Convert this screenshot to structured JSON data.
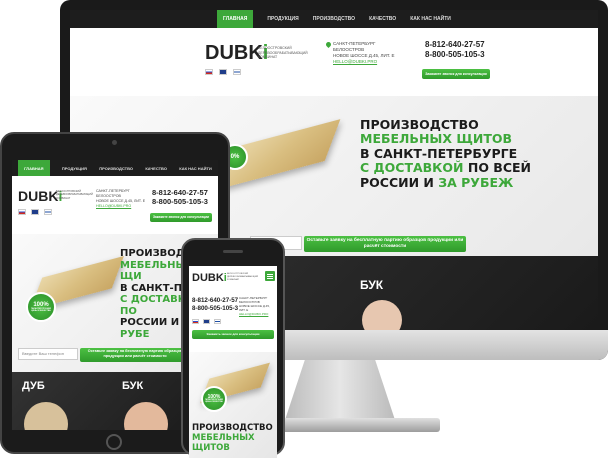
{
  "brand": {
    "logo_main": "DUBK",
    "logo_accent": "i",
    "tagline": "БЕЛООСТРОВСКИЙ ДЕРЕВООБРАБАТЫВАЮЩИЙ КОМБИНАТ"
  },
  "nav": [
    "ГЛАВНАЯ",
    "ПРОДУКЦИЯ",
    "ПРОИЗВОДСТВО",
    "КАЧЕСТВО",
    "КАК НАС НАЙТИ"
  ],
  "address": {
    "line1": "САНКТ-ПЕТЕРБУРГ",
    "line2": "БЕЛООСТРОВ",
    "line3": "НОВОЕ ШОССЕ Д.45, ЛИТ. Е",
    "email": "HELLO@DUBKI.PRO"
  },
  "phones": {
    "phone1": "8-812-640-27-57",
    "phone2": "8-800-505-105-3",
    "callback": "Закажите звонок для консультации",
    "callback_short": "Закажить звонок для консультации"
  },
  "hero": {
    "line1": "ПРОИЗВОДСТВО",
    "line2": "МЕБЕЛЬНЫХ ЩИТОВ",
    "line3": "В САНКТ-ПЕТЕРБУРГЕ",
    "line4a": "С ДОСТАВКОЙ",
    "line4b": " ПО ВСЕЙ",
    "line5a": "РОССИИ И ",
    "line5b": "ЗА РУБЕЖ",
    "tablet_line1": "ПРОИЗВОДСТВО",
    "tablet_line2": "МЕБЕЛЬНЫХ ЩИ",
    "tablet_line3": "В САНКТ-ПЕТЕРБ",
    "tablet_line4": "С ДОСТАВКОЙ ПО",
    "tablet_line5a": "РОССИИ И ",
    "tablet_line5b": "ЗА РУБЕ",
    "phone_line1": "ПРОИЗВОДСТВО",
    "phone_line2": "МЕБЕЛЬНЫХ ЩИТОВ"
  },
  "badge": {
    "value": "100%",
    "text": "ГАРАНТИЯ ЛУЧШЕЙ ЦЕНЫ И КАЧЕСТВА",
    "desktop_partial": "0%"
  },
  "form": {
    "phone_placeholder": "Введите Ваш телефон",
    "desktop_placeholder": "ш телефон",
    "submit": "Оставьте заявку на бесплатную партию образцов продукции или расчёт стоимости",
    "tablet_submit": "Оставьте заявку на бесплатную партию образцов продукции или расчёт стоимости"
  },
  "categories": {
    "oak": "ДУБ",
    "beech": "БУК"
  },
  "colors": {
    "accent": "#3da83a",
    "dark": "#1d1d1d"
  }
}
